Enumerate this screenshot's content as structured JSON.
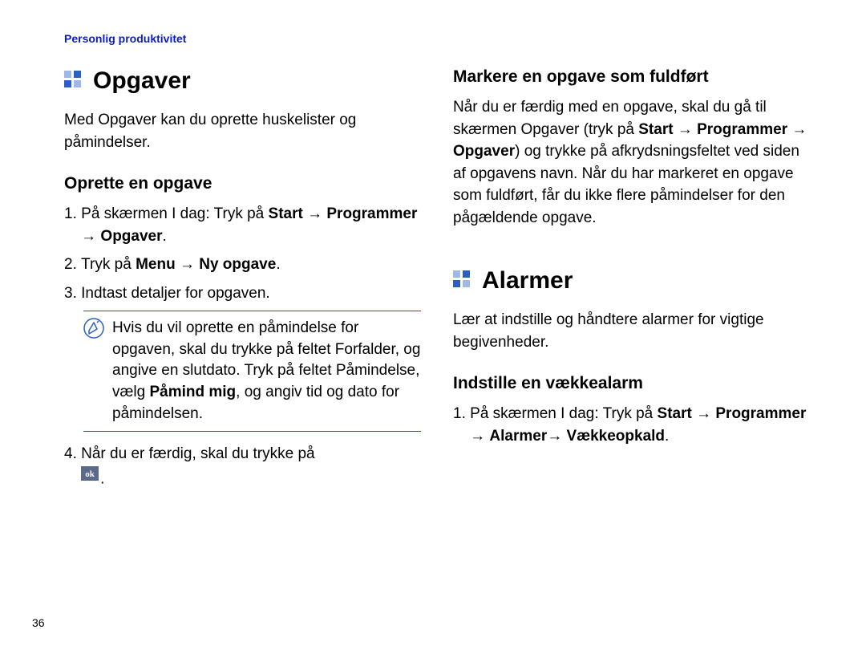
{
  "breadcrumb": "Personlig produktivitet",
  "page_number": "36",
  "left": {
    "h1": "Opgaver",
    "intro": "Med Opgaver kan du oprette huskelister og påmindelser.",
    "sub1": "Oprette en opgave",
    "step1_pre": "På skærmen I dag: Tryk på ",
    "step1_b1": "Start",
    "step1_arrow": " → ",
    "step1_b2": "Programmer",
    "step1_b3": "Opgaver",
    "step1_dot": ".",
    "step2_pre": "Tryk på ",
    "step2_b1": "Menu",
    "step2_b2": "Ny opgave",
    "step3": "Indtast detaljer for opgaven.",
    "note_pre": "Hvis du vil oprette en påmindelse for opgaven, skal du trykke på feltet Forfalder, og angive en slutdato. Tryk på feltet Påmindelse, vælg ",
    "note_b": "Påmind mig",
    "note_post": ", og angiv tid og dato for påmindelsen.",
    "step4_pre": "Når du er færdig, skal du trykke på ",
    "step4_post": "."
  },
  "right": {
    "sub1": "Markere en opgave som fuldført",
    "mark_p1": "Når du er færdig med en opgave, skal du gå til skærmen Opgaver (tryk på ",
    "mark_b1": "Start",
    "mark_arrow": " → ",
    "mark_b2": "Programmer",
    "mark_b3": "Opgaver",
    "mark_p2": ") og trykke på afkrydsningsfeltet ved siden af opgavens navn. Når du har markeret en opgave som fuldført, får du ikke flere påmindelser for den pågældende opgave.",
    "h1": "Alarmer",
    "alarm_intro": "Lær at indstille og håndtere alarmer for vigtige begivenheder.",
    "sub2": "Indstille en vækkealarm",
    "a_step1_pre": "På skærmen I dag: Tryk på ",
    "a_step1_b1": "Start",
    "a_step1_b2": "Programmer",
    "a_step1_b3": "Alarmer",
    "a_step1_b4": "Vækkeopkald",
    "a_step1_dot": "."
  }
}
